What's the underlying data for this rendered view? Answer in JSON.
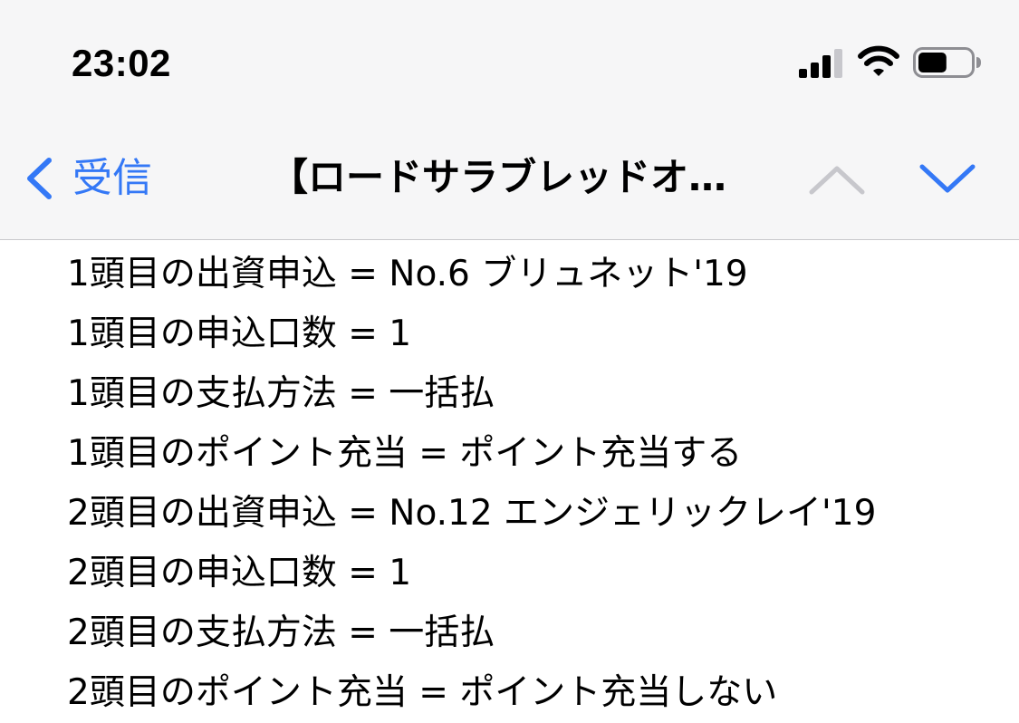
{
  "status_bar": {
    "time": "23:02",
    "signal_icon": "cellular-signal-icon",
    "wifi_icon": "wifi-icon",
    "battery_icon": "battery-icon",
    "battery_level": 0.55
  },
  "nav": {
    "back_label": "受信",
    "title": "【ロードサラブレッドオ…",
    "prev_icon": "chevron-up-icon",
    "next_icon": "chevron-down-icon",
    "accent_color": "#3478f6"
  },
  "email": {
    "lines": [
      "1頭目の出資申込 = No.6 ブリュネット'19",
      "1頭目の申込口数 = 1",
      "1頭目の支払方法 = 一括払",
      "1頭目のポイント充当 = ポイント充当する",
      "2頭目の出資申込 = No.12 エンジェリックレイ'19",
      "2頭目の申込口数 = 1",
      "2頭目の支払方法 = 一括払",
      "2頭目のポイント充当 = ポイント充当しない"
    ]
  }
}
